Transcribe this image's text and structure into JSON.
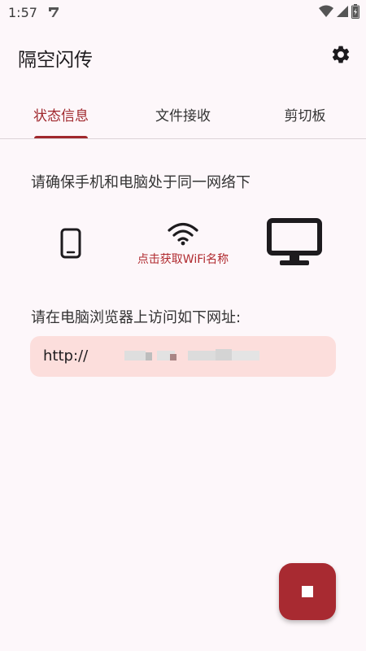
{
  "status_bar": {
    "time": "1:57",
    "icons": [
      "app-notification-icon",
      "wifi-signal-icon",
      "cell-signal-icon",
      "battery-icon"
    ]
  },
  "app_bar": {
    "title": "隔空闪传",
    "settings_icon": "gear-icon"
  },
  "tabs": [
    {
      "label": "状态信息",
      "active": true
    },
    {
      "label": "文件接收",
      "active": false
    },
    {
      "label": "剪切板",
      "active": false
    }
  ],
  "main": {
    "prompt": "请确保手机和电脑处于同一网络下",
    "wifi_link": "点击获取WiFi名称",
    "visit_prompt": "请在电脑浏览器上访问如下网址:",
    "url_prefix": "http://",
    "url_obscured": true
  },
  "fab": {
    "icon": "stop-icon"
  },
  "colors": {
    "accent": "#a0282d",
    "background": "#fdf7fa",
    "url_field": "#fcdedc",
    "fab": "#a82a31"
  }
}
